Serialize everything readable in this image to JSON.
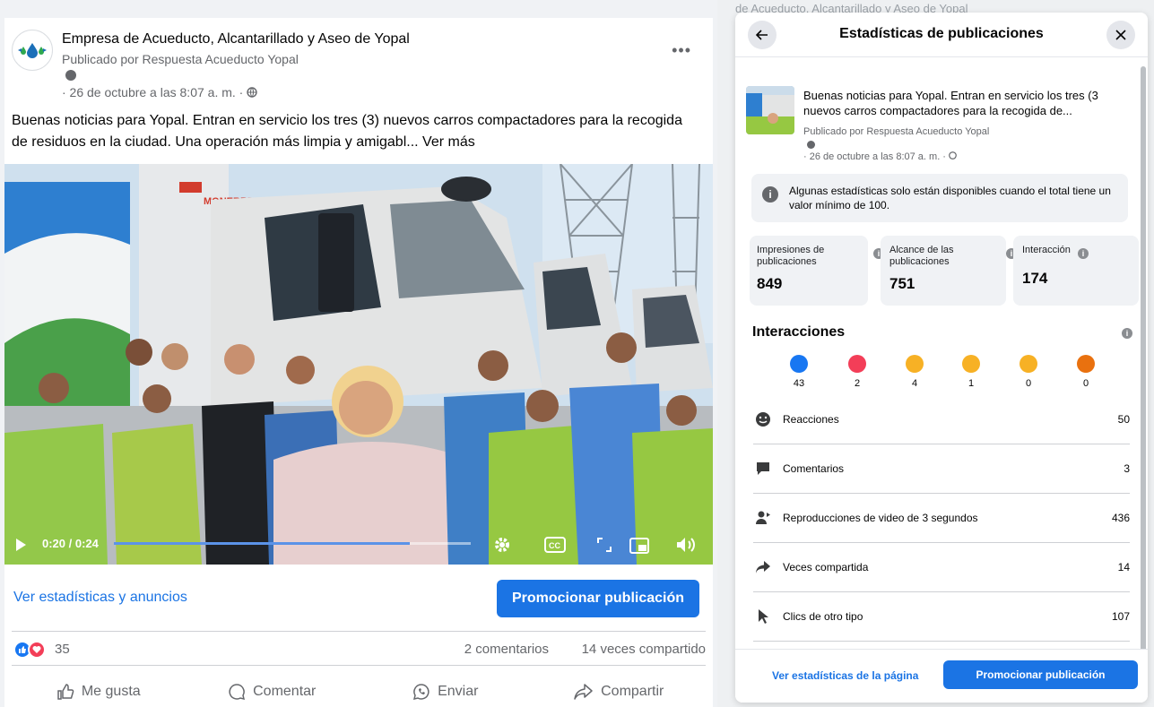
{
  "post": {
    "page_name": "Empresa de Acueducto, Alcantarillado y Aseo de Yopal",
    "published_by": "Publicado por Respuesta Acueducto Yopal",
    "date": "· 26 de octubre a las 8:07 a. m. ·",
    "more_menu": "•••",
    "text": "Buenas noticias para Yopal. Entran en servicio los tres (3)  nuevos carros compactadores para la recogida de residuos en la ciudad.   Una operación más limpia y amigabl...",
    "see_more": "Ver más",
    "video": {
      "time": "0:20 / 0:24",
      "progress": 0.83,
      "truck_brand": "MONERRE"
    },
    "stats_link": "Ver estadísticas y anuncios",
    "promote_button": "Promocionar publicación",
    "reaction_count": "35",
    "comments": "2 comentarios",
    "shares": "14 veces compartido",
    "actions": {
      "like": "Me gusta",
      "comment": "Comentar",
      "send": "Enviar",
      "share": "Compartir"
    }
  },
  "background_title": "de Acueducto, Alcantarillado y Aseo de Yopal",
  "modal": {
    "title": "Estadísticas de publicaciones",
    "post_preview": {
      "line1": "Buenas noticias para Yopal. Entran en servicio los tres (3",
      "line2": "nuevos carros compactadores para la recogida de...",
      "published_by": "Publicado por Respuesta Acueducto Yopal",
      "date": "· 26 de octubre a las 8:07 a. m. ·"
    },
    "notice": "Algunas estadísticas solo están disponibles cuando el total tiene un valor mínimo de 100.",
    "metrics": [
      {
        "label": "Impresiones de publicaciones",
        "value": "849"
      },
      {
        "label": "Alcance de las publicaciones",
        "value": "751"
      },
      {
        "label": "Interacción",
        "value": "174"
      }
    ],
    "interactions_title": "Interacciones",
    "reactions": [
      {
        "name": "like",
        "count": "43",
        "color": "#1877f2"
      },
      {
        "name": "love",
        "count": "2",
        "color": "#f33e58"
      },
      {
        "name": "haha",
        "count": "4",
        "color": "#f7b125"
      },
      {
        "name": "wow",
        "count": "1",
        "color": "#f7b125"
      },
      {
        "name": "sad",
        "count": "0",
        "color": "#f7b125"
      },
      {
        "name": "angry",
        "count": "0",
        "color": "#e9710f"
      }
    ],
    "stat_rows": [
      {
        "label": "Reacciones",
        "value": "50"
      },
      {
        "label": "Comentarios",
        "value": "3"
      },
      {
        "label": "Reproducciones de video de 3 segundos",
        "value": "436"
      },
      {
        "label": "Veces compartida",
        "value": "14"
      },
      {
        "label": "Clics de otro tipo",
        "value": "107"
      }
    ],
    "page_stats_link": "Ver estadísticas de la página",
    "promote_button": "Promocionar publicación"
  },
  "colors": {
    "accent": "#1b74e4",
    "secondary_text": "#65676b"
  }
}
